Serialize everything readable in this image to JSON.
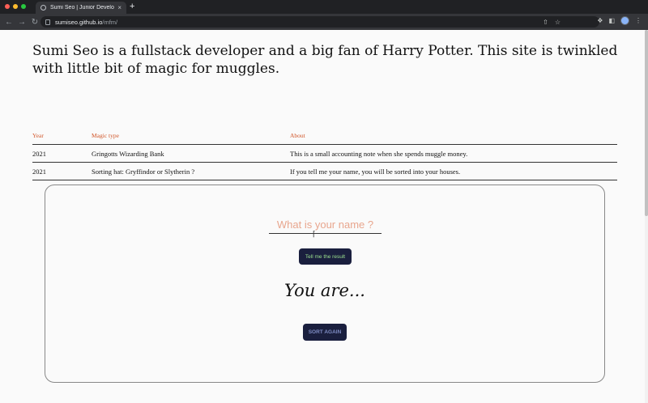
{
  "browser": {
    "tab_title": "Sumi Seo | Junior Developper",
    "close_icon": "×",
    "new_tab_icon": "+",
    "url_host": "sumiseo.github.io",
    "url_path": "/mfm/",
    "colors": {
      "close": "#ff5f57",
      "minimize": "#febc2e",
      "zoom": "#28c840"
    }
  },
  "intro": {
    "text": "Sumi Seo is a fullstack developer and a big fan of Harry Potter. This site is twinkled with little bit of magic for muggles."
  },
  "table": {
    "headers": [
      "Year",
      "Magic type",
      "About"
    ],
    "rows": [
      {
        "year": "2021",
        "type": "Gringotts Wizarding Bank",
        "about": "This is a small accounting note when she spends muggle money."
      },
      {
        "year": "2021",
        "type": "Sorting hat: Gryffindor or Slytherin ?",
        "about": "If you tell me your name, you will be sorted into your houses."
      }
    ]
  },
  "sorting": {
    "input_placeholder": "What is your name ?",
    "input_value": "",
    "result_button": "Tell me the result",
    "result_text": "You are...",
    "sort_again_button": "SORT AGAIN"
  }
}
